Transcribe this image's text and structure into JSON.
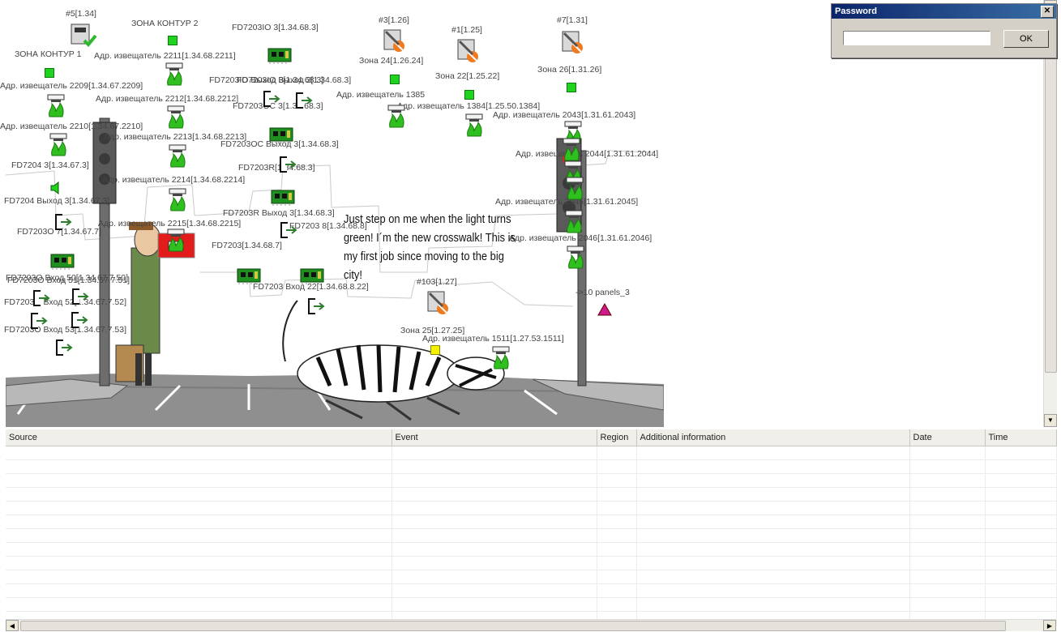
{
  "map": {
    "zones": {
      "zone_contour_1": "ЗОНА КОНТУР 1",
      "zone_contour_2": "ЗОНА КОНТУР 2",
      "zone_24": "Зона 24[1.26.24]",
      "zone_22": "Зона 22[1.25.22]",
      "zone_26": "Зона 26[1.31.26]",
      "zone_25": "Зона 25[1.27.25]"
    },
    "panels": {
      "p5": "#5[1.34]",
      "p3": "#3[1.26]",
      "p1": "#1[1.25]",
      "p7": "#7[1.31]",
      "p103": "#103[1.27]",
      "panels_3": "->10 panels_3"
    },
    "detectors": {
      "d2209": "Адр. извещатель 2209[1.34.67.2209]",
      "d2210": "Адр. извещатель 2210[1.34.67.2210]",
      "d2211": "Адр. извещатель 2211[1.34.68.2211]",
      "d2212": "Адр. извещатель 2212[1.34.68.2212]",
      "d2213": "Адр. извещатель 2213[1.34.68.2213]",
      "d2214": "Адр. извещатель 2214[1.34.68.2214]",
      "d2215": "Адр. извещатель 2215[1.34.68.2215]",
      "d1385": "Адр. извещатель 1385",
      "d1384": "Адр. извещатель 1384[1.25.50.1384]",
      "d2043": "Адр. извещатель 2043[1.31.61.2043]",
      "d2044": "Адр. извещатель 2044[1.31.61.2044]",
      "d2045": "Адр. извещатель 2045[1.31.61.2045]",
      "d2046": "Адр. извещатель 2046[1.31.61.2046]",
      "d1511": "Адр. извещатель 1511[1.27.53.1511]"
    },
    "modules": {
      "m_io3": "FD7203IO 3[1.34.68.3]",
      "m_out3_a": "FD7203IO Выход 3[1.34.68.3]",
      "m_out3_b": "FD7203IO Выход 3[1.34.68.3]",
      "m_oc3": "FD7203OC 3[1.34.68.3]",
      "m_oc_out3": "FD7203OC Выход 3[1.34.68.3]",
      "m_r": "FD7203R[1.34.68.3]",
      "m_r_out3": "FD7203R Выход 3[1.34.68.3]",
      "m_8": "FD7203 8[1.34.68.8]",
      "m_7203": "FD7203[1.34.68.7]",
      "m_in22": "FD7203 Вход 22[1.34.68.8.22]",
      "m_7204": "FD7204 3[1.34.67.3]",
      "m_7204_out": "FD7204 Выход 3[1.34.67.3]",
      "m_o7": "FD7203O 7[1.34.67.7]",
      "m_in50": "FD7203O Вход 50[1.34.67.7.50]",
      "m_in51": "FD7203O Вход 51[1.34.67.7.51]",
      "m_in52": "FD7203O Вход 52[1.34.67.7.52]",
      "m_in53": "FD7203O Вход 53[1.34.67.7.53]"
    },
    "speech": "Just step on me when the light turns green! I´m the new crosswalk! This is my first job since moving to the big city!"
  },
  "password_dialog": {
    "title": "Password",
    "close_glyph": "✕",
    "value": "",
    "ok_label": "OK"
  },
  "log": {
    "columns": [
      "Source",
      "Event",
      "Region",
      "Additional information",
      "Date",
      "Time"
    ],
    "row_count": 13
  },
  "colors": {
    "zone_ok": "#1fd31f",
    "zone_warn": "#f2f200",
    "alarm": "#cc1a8a",
    "titlebar": "#0a246a"
  }
}
